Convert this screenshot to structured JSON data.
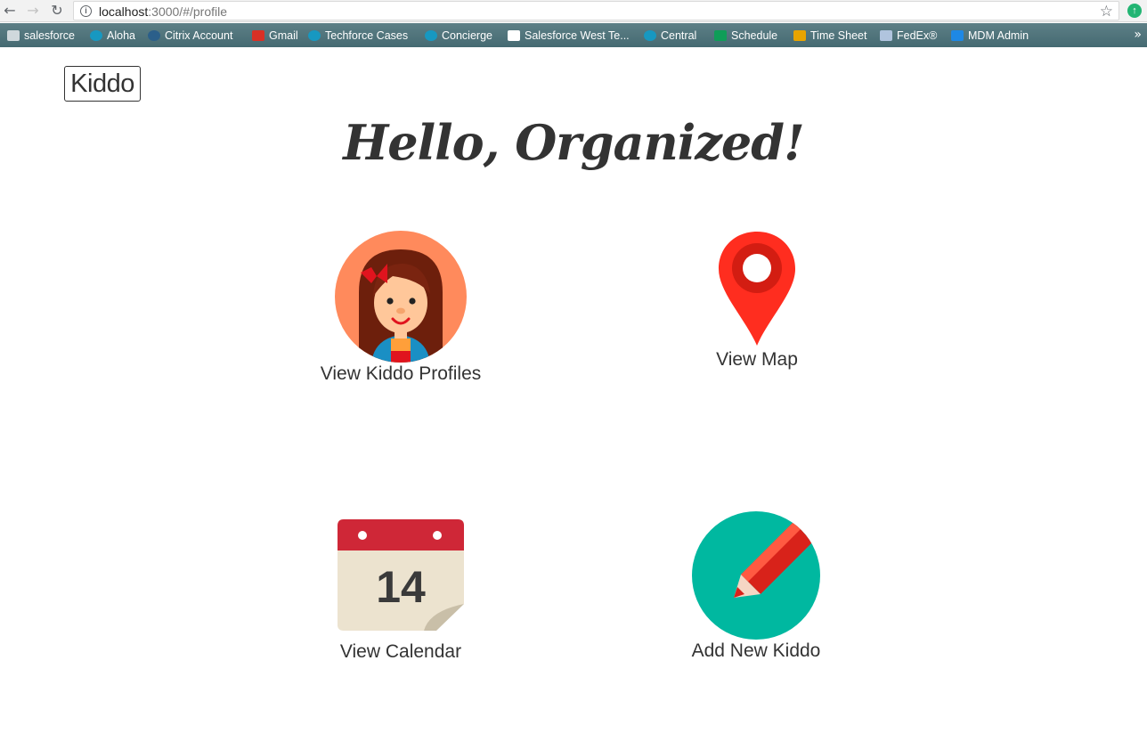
{
  "browser": {
    "url_host": "localhost",
    "url_rest": ":3000/#/profile",
    "bookmarks": [
      {
        "label": "salesforce",
        "icon": "folder-icon",
        "color": "#cfd8dc"
      },
      {
        "label": "Aloha",
        "icon": "cloud-icon",
        "color": "#1798c1"
      },
      {
        "label": "Citrix Account",
        "icon": "linkedin-icon",
        "color": "#2b5f8a"
      },
      {
        "label": "Gmail",
        "icon": "gmail-icon",
        "color": "#d93025"
      },
      {
        "label": "Techforce Cases",
        "icon": "cloud-icon",
        "color": "#1798c1"
      },
      {
        "label": "Concierge",
        "icon": "cloud-icon",
        "color": "#1798c1"
      },
      {
        "label": "Salesforce West Te...",
        "icon": "page-icon",
        "color": "#ffffff"
      },
      {
        "label": "Central",
        "icon": "cloud-icon",
        "color": "#1798c1"
      },
      {
        "label": "Schedule",
        "icon": "sheet-icon",
        "color": "#0f9d58"
      },
      {
        "label": "Time Sheet",
        "icon": "timesheet-icon",
        "color": "#e8a400"
      },
      {
        "label": "FedEx®",
        "icon": "flag-icon",
        "color": "#b0c4de"
      },
      {
        "label": "MDM Admin",
        "icon": "aw-icon",
        "color": "#1e88e5"
      }
    ],
    "more": "»"
  },
  "brand": "Kiddo",
  "heading": "Hello, Organized!",
  "tiles": {
    "profiles": "View Kiddo Profiles",
    "map": "View Map",
    "calendar": "View Calendar",
    "calendar_day": "14",
    "add": "Add New Kiddo"
  },
  "colors": {
    "profile_bg": "#ff8a5c",
    "map_pin": "#ff2d1f",
    "calendar_header": "#cf2737",
    "calendar_body": "#ece3cf",
    "add_bg": "#00b8a0",
    "pencil": "#d8221a"
  }
}
